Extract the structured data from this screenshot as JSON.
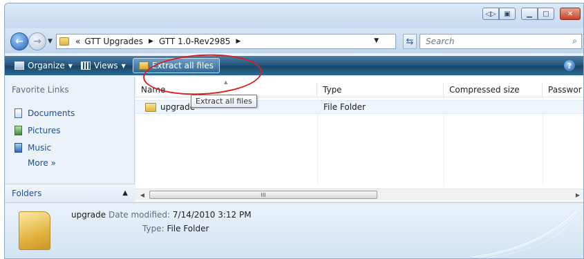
{
  "breadcrumb": {
    "overflow": "«",
    "items": [
      "GTT Upgrades",
      "GTT 1.0-Rev2985"
    ]
  },
  "search": {
    "placeholder": "Search"
  },
  "toolbar": {
    "organize": "Organize",
    "views": "Views",
    "extract": "Extract all files",
    "tooltip": "Extract all files"
  },
  "navpane": {
    "title": "Favorite Links",
    "links": [
      "Documents",
      "Pictures",
      "Music"
    ],
    "more": "More",
    "folders": "Folders"
  },
  "columns": [
    "Name",
    "Type",
    "Compressed size",
    "Passwor"
  ],
  "rows": [
    {
      "name": "upgrade",
      "type": "File Folder"
    }
  ],
  "details": {
    "name": "upgrade",
    "modified_label": "Date modified:",
    "modified": "7/14/2010 3:12 PM",
    "type_label": "Type:",
    "type": "File Folder"
  },
  "scrollbar_grip": "III",
  "colors": {
    "accent": "#1a4f9a",
    "command_bar": "#22527a",
    "highlight_ring": "#d81e1e"
  }
}
